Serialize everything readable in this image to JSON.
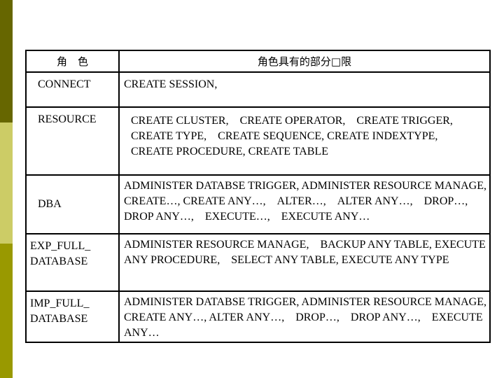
{
  "decor": {
    "colors": [
      "#666600",
      "#cccc66",
      "#999900"
    ]
  },
  "table": {
    "headers": [
      "角　色",
      "角色具有的部分□限"
    ],
    "rows": [
      {
        "role": "CONNECT",
        "privileges": "CREATE SESSION,"
      },
      {
        "role": "RESOURCE",
        "privileges": "CREATE CLUSTER,　CREATE OPERATOR,　CREATE TRIGGER,　CREATE TYPE,　CREATE SEQUENCE, CREATE INDEXTYPE,　CREATE PROCEDURE, CREATE TABLE"
      },
      {
        "role": "DBA",
        "privileges": "ADMINISTER DATABSE TRIGGER, ADMINISTER RESOURCE MANAGE,　CREATE…, CREATE ANY…,　ALTER…,　ALTER ANY…,　DROP…, DROP ANY…,　EXECUTE…,　EXECUTE ANY…"
      },
      {
        "role": "EXP_FULL_ DATABASE",
        "privileges": "ADMINISTER RESOURCE MANAGE,　BACKUP ANY TABLE, EXECUTE ANY PROCEDURE,　SELECT ANY TABLE, EXECUTE ANY TYPE"
      },
      {
        "role": "IMP_FULL_ DATABASE",
        "privileges": "ADMINISTER DATABSE TRIGGER, ADMINISTER RESOURCE MANAGE,　CREATE ANY…, ALTER ANY…,　DROP…,　DROP ANY…,　EXECUTE ANY…"
      }
    ]
  }
}
